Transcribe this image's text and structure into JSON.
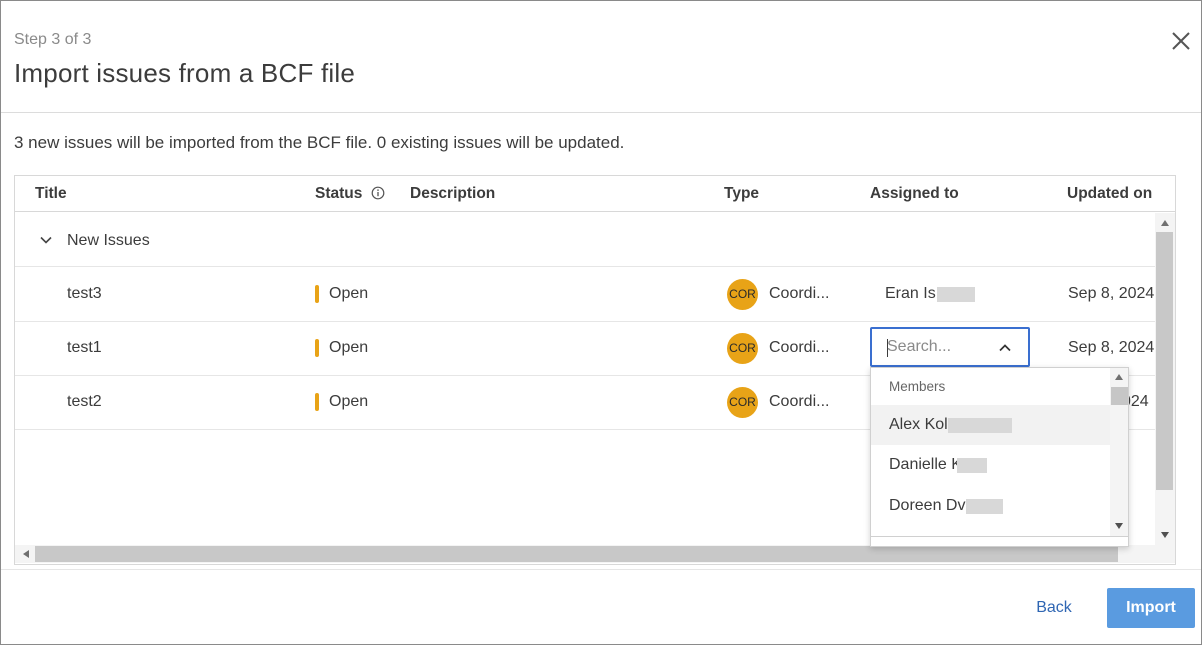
{
  "header": {
    "step": "Step 3 of 3",
    "title": "Import issues from a BCF file"
  },
  "summary": "3 new issues will be imported from the BCF file. 0 existing issues will be updated.",
  "table": {
    "columns": {
      "title": "Title",
      "status": "Status",
      "description": "Description",
      "type": "Type",
      "assigned_to": "Assigned to",
      "updated_on": "Updated on"
    },
    "group_label": "New Issues",
    "rows": [
      {
        "title": "test3",
        "status": "Open",
        "type_badge": "COR",
        "type": "Coordi...",
        "assigned_to": "Eran Is",
        "updated_on": "Sep 8, 2024"
      },
      {
        "title": "test1",
        "status": "Open",
        "type_badge": "COR",
        "type": "Coordi...",
        "assigned_to": "",
        "updated_on": "Sep 8, 2024"
      },
      {
        "title": "test2",
        "status": "Open",
        "type_badge": "COR",
        "type": "Coordi...",
        "assigned_to": "",
        "updated_on": "024"
      }
    ]
  },
  "assignee_search": {
    "placeholder": "Search...",
    "section_label": "Members",
    "members": [
      "Alex Kol",
      "Danielle K",
      "Doreen Dv"
    ]
  },
  "footer": {
    "back_label": "Back",
    "import_label": "Import"
  },
  "colors": {
    "status_open": "#e8a317",
    "type_badge": "#e8a317",
    "primary_button": "#5a9be0",
    "link": "#2f66b3",
    "focus_border": "#3a6fd0"
  }
}
